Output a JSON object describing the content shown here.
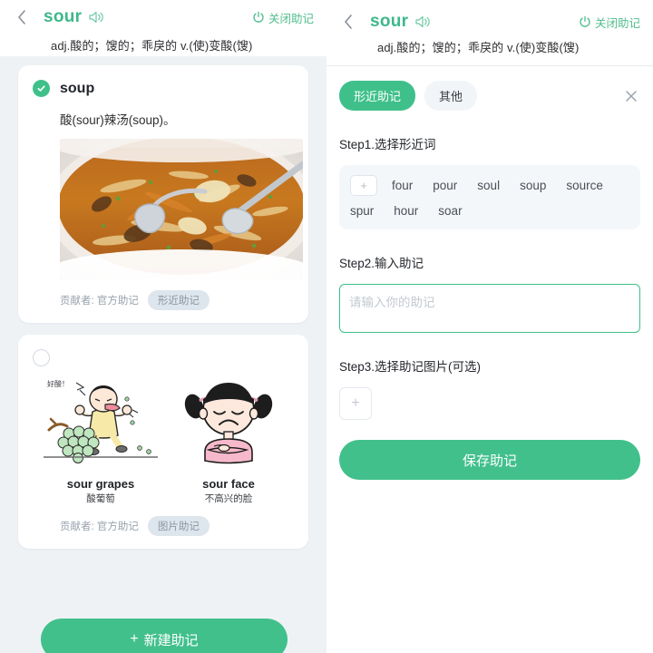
{
  "left": {
    "header": {
      "back_icon": "chevron-left-icon",
      "word": "sour",
      "speaker_icon": "speaker-icon",
      "power_icon": "power-icon",
      "close_label": "关闭助记",
      "definition": "adj.酸的；馊的；乖戾的 v.(使)变酸(馊)"
    },
    "cards": [
      {
        "selected": true,
        "word": "soup",
        "note": "酸(sour)辣汤(soup)。",
        "contributor_label": "贡献者: 官方助记",
        "tag": "形近助记"
      },
      {
        "selected": false,
        "illustrations": [
          {
            "en": "sour grapes",
            "cn": "酸葡萄",
            "bubble": "好酸！"
          },
          {
            "en": "sour face",
            "cn": "不高兴的脸"
          }
        ],
        "contributor_label": "贡献者: 官方助记",
        "tag": "图片助记"
      }
    ],
    "create_button": {
      "plus": "+",
      "label": "新建助记"
    }
  },
  "right": {
    "header": {
      "back_icon": "chevron-left-icon",
      "word": "sour",
      "speaker_icon": "speaker-icon",
      "power_icon": "power-icon",
      "close_label": "关闭助记",
      "definition": "adj.酸的；馊的；乖戾的 v.(使)变酸(馊)"
    },
    "tabs": [
      {
        "label": "形近助记",
        "active": true
      },
      {
        "label": "其他",
        "active": false
      }
    ],
    "close_icon": "close-icon",
    "step1": {
      "label": "Step1.选择形近词",
      "add_glyph": "+",
      "words": [
        "four",
        "pour",
        "soul",
        "soup",
        "source",
        "spur",
        "hour",
        "soar"
      ]
    },
    "step2": {
      "label": "Step2.输入助记",
      "placeholder": "请输入你的助记",
      "value": ""
    },
    "step3": {
      "label": "Step3.选择助记图片(可选)",
      "add_glyph": "+"
    },
    "save_button": "保存助记"
  },
  "colors": {
    "accent_green": "#3fc08a",
    "button_green": "#42c08c",
    "panel_bg": "#eef2f5",
    "tag_bg": "#dde5ed",
    "text_primary": "#23262b",
    "text_muted": "#9aa3ad"
  }
}
